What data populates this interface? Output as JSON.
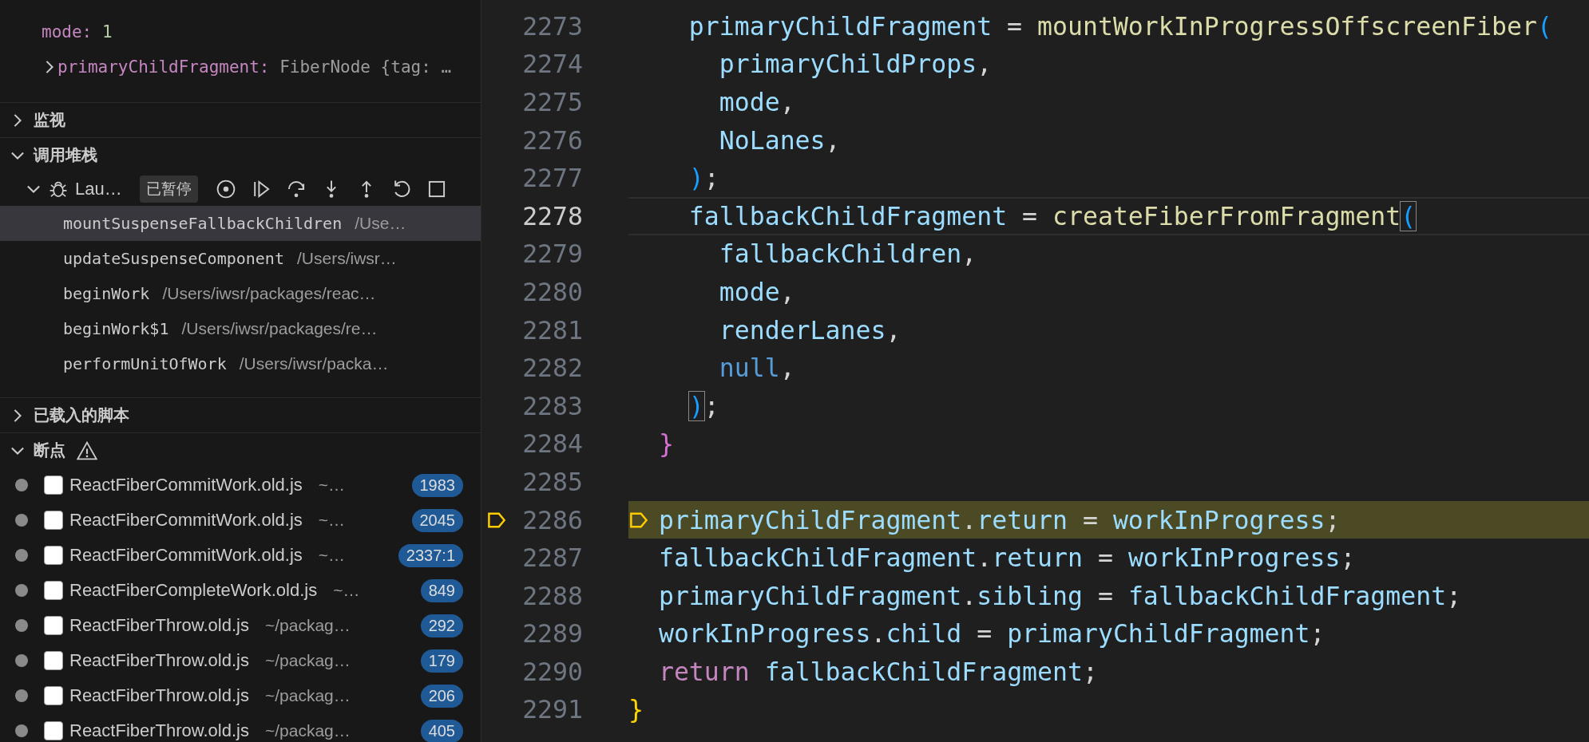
{
  "variables": [
    {
      "name": "mode:",
      "value": "1",
      "expandable": false
    },
    {
      "name": "primaryChildFragment:",
      "value": "FiberNode {tag: …",
      "expandable": true
    }
  ],
  "watch": {
    "title": "监视",
    "expanded": false
  },
  "call_stack": {
    "title": "调用堆栈",
    "expanded": true,
    "session": {
      "name": "Lau…",
      "status": "已暂停",
      "expanded": true
    },
    "frames": [
      {
        "name": "mountSuspenseFallbackChildren",
        "path": "/Use…",
        "selected": true
      },
      {
        "name": "updateSuspenseComponent",
        "path": "/Users/iwsr…",
        "selected": false
      },
      {
        "name": "beginWork",
        "path": "/Users/iwsr/packages/reac…",
        "selected": false
      },
      {
        "name": "beginWork$1",
        "path": "/Users/iwsr/packages/re…",
        "selected": false
      },
      {
        "name": "performUnitOfWork",
        "path": "/Users/iwsr/packa…",
        "selected": false
      }
    ]
  },
  "loaded_scripts": {
    "title": "已载入的脚本",
    "expanded": false
  },
  "breakpoints": {
    "title": "断点",
    "expanded": true,
    "warning": true,
    "items": [
      {
        "file": "ReactFiberCommitWork.old.js",
        "path": "~…",
        "line": "1983",
        "checked": false
      },
      {
        "file": "ReactFiberCommitWork.old.js",
        "path": "~…",
        "line": "2045",
        "checked": false
      },
      {
        "file": "ReactFiberCommitWork.old.js",
        "path": "~…",
        "line": "2337:1",
        "checked": false
      },
      {
        "file": "ReactFiberCompleteWork.old.js",
        "path": "~…",
        "line": "849",
        "checked": false
      },
      {
        "file": "ReactFiberThrow.old.js",
        "path": "~/packag…",
        "line": "292",
        "checked": false
      },
      {
        "file": "ReactFiberThrow.old.js",
        "path": "~/packag…",
        "line": "179",
        "checked": false
      },
      {
        "file": "ReactFiberThrow.old.js",
        "path": "~/packag…",
        "line": "206",
        "checked": false
      },
      {
        "file": "ReactFiberThrow.old.js",
        "path": "~/packag…",
        "line": "405",
        "checked": false
      }
    ]
  },
  "editor": {
    "lines": [
      {
        "number": "2273",
        "current": false,
        "paused": false,
        "tokens": [
          {
            "text": "    primaryChildFragment",
            "kind": "var"
          },
          {
            "text": " = ",
            "kind": "punct"
          },
          {
            "text": "mountWorkInProgressOffscreenFiber",
            "kind": "func"
          },
          {
            "text": "(",
            "kind": "bracket"
          }
        ]
      },
      {
        "number": "2274",
        "current": false,
        "paused": false,
        "tokens": [
          {
            "text": "      primaryChildProps",
            "kind": "var"
          },
          {
            "text": ",",
            "kind": "punct"
          }
        ]
      },
      {
        "number": "2275",
        "current": false,
        "paused": false,
        "tokens": [
          {
            "text": "      mode",
            "kind": "var"
          },
          {
            "text": ",",
            "kind": "punct"
          }
        ]
      },
      {
        "number": "2276",
        "current": false,
        "paused": false,
        "tokens": [
          {
            "text": "      NoLanes",
            "kind": "var"
          },
          {
            "text": ",",
            "kind": "punct"
          }
        ]
      },
      {
        "number": "2277",
        "current": false,
        "paused": false,
        "tokens": [
          {
            "text": "    )",
            "kind": "bracket"
          },
          {
            "text": ";",
            "kind": "punct"
          }
        ]
      },
      {
        "number": "2278",
        "current": true,
        "paused": false,
        "tokens": [
          {
            "text": "    fallbackChildFragment",
            "kind": "var"
          },
          {
            "text": " = ",
            "kind": "punct"
          },
          {
            "text": "createFiberFromFragment",
            "kind": "func"
          },
          {
            "text": "(",
            "kind": "match"
          }
        ]
      },
      {
        "number": "2279",
        "current": false,
        "paused": false,
        "tokens": [
          {
            "text": "      fallbackChildren",
            "kind": "var"
          },
          {
            "text": ",",
            "kind": "punct"
          }
        ]
      },
      {
        "number": "2280",
        "current": false,
        "paused": false,
        "tokens": [
          {
            "text": "      mode",
            "kind": "var"
          },
          {
            "text": ",",
            "kind": "punct"
          }
        ]
      },
      {
        "number": "2281",
        "current": false,
        "paused": false,
        "tokens": [
          {
            "text": "      renderLanes",
            "kind": "var"
          },
          {
            "text": ",",
            "kind": "punct"
          }
        ]
      },
      {
        "number": "2282",
        "current": false,
        "paused": false,
        "tokens": [
          {
            "text": "      null",
            "kind": "literal"
          },
          {
            "text": ",",
            "kind": "punct"
          }
        ]
      },
      {
        "number": "2283",
        "current": false,
        "paused": false,
        "tokens": [
          {
            "text": "    )",
            "kind": "match"
          },
          {
            "text": ";",
            "kind": "punct"
          }
        ]
      },
      {
        "number": "2284",
        "current": false,
        "paused": false,
        "tokens": [
          {
            "text": "  }",
            "kind": "brace"
          }
        ]
      },
      {
        "number": "2285",
        "current": false
      },
      {
        "number": "2286",
        "current": false,
        "paused": true,
        "tokens": [
          {
            "text": "  primaryChildFragment",
            "kind": "var"
          },
          {
            "text": ".",
            "kind": "punct"
          },
          {
            "text": "return",
            "kind": "var"
          },
          {
            "text": " = ",
            "kind": "punct"
          },
          {
            "text": "workInProgress",
            "kind": "var"
          },
          {
            "text": ";",
            "kind": "punct"
          }
        ]
      },
      {
        "number": "2287",
        "current": false,
        "paused": false,
        "tokens": [
          {
            "text": "  fallbackChildFragment",
            "kind": "var"
          },
          {
            "text": ".",
            "kind": "punct"
          },
          {
            "text": "return",
            "kind": "var"
          },
          {
            "text": " = ",
            "kind": "punct"
          },
          {
            "text": "workInProgress",
            "kind": "var"
          },
          {
            "text": ";",
            "kind": "punct"
          }
        ]
      },
      {
        "number": "2288",
        "current": false,
        "paused": false,
        "tokens": [
          {
            "text": "  primaryChildFragment",
            "kind": "var"
          },
          {
            "text": ".",
            "kind": "punct"
          },
          {
            "text": "sibling",
            "kind": "var"
          },
          {
            "text": " = ",
            "kind": "punct"
          },
          {
            "text": "fallbackChildFragment",
            "kind": "var"
          },
          {
            "text": ";",
            "kind": "punct"
          }
        ]
      },
      {
        "number": "2289",
        "current": false,
        "paused": false,
        "tokens": [
          {
            "text": "  workInProgress",
            "kind": "var"
          },
          {
            "text": ".",
            "kind": "punct"
          },
          {
            "text": "child",
            "kind": "var"
          },
          {
            "text": " = ",
            "kind": "punct"
          },
          {
            "text": "primaryChildFragment",
            "kind": "var"
          },
          {
            "text": ";",
            "kind": "punct"
          }
        ]
      },
      {
        "number": "2290",
        "current": false,
        "paused": false,
        "tokens": [
          {
            "text": "  return",
            "kind": "keyword"
          },
          {
            "text": " fallbackChildFragment",
            "kind": "var"
          },
          {
            "text": ";",
            "kind": "punct"
          }
        ]
      },
      {
        "number": "2291",
        "current": false,
        "paused": false,
        "tokens": [
          {
            "text": "}",
            "kind": "brace2"
          }
        ]
      }
    ]
  }
}
